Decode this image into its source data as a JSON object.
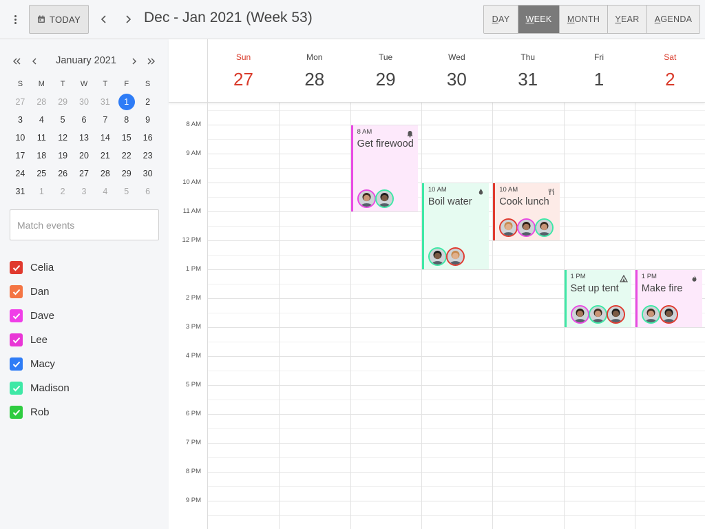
{
  "header": {
    "today_label": "TODAY",
    "title": "Dec - Jan 2021 (Week 53)",
    "views": [
      {
        "label": "DAY",
        "key": "D",
        "rest": "AY",
        "active": false
      },
      {
        "label": "WEEK",
        "key": "W",
        "rest": "EEK",
        "active": true
      },
      {
        "label": "MONTH",
        "key": "M",
        "rest": "ONTH",
        "active": false
      },
      {
        "label": "YEAR",
        "key": "Y",
        "rest": "EAR",
        "active": false
      },
      {
        "label": "AGENDA",
        "key": "A",
        "rest": "GENDA",
        "active": false
      }
    ]
  },
  "mini_calendar": {
    "title": "January 2021",
    "weekdays": [
      "S",
      "M",
      "T",
      "W",
      "T",
      "F",
      "S"
    ],
    "weeks": [
      [
        "27",
        "28",
        "29",
        "30",
        "31",
        "1",
        "2"
      ],
      [
        "3",
        "4",
        "5",
        "6",
        "7",
        "8",
        "9"
      ],
      [
        "10",
        "11",
        "12",
        "13",
        "14",
        "15",
        "16"
      ],
      [
        "17",
        "18",
        "19",
        "20",
        "21",
        "22",
        "23"
      ],
      [
        "24",
        "25",
        "26",
        "27",
        "28",
        "29",
        "30"
      ],
      [
        "31",
        "1",
        "2",
        "3",
        "4",
        "5",
        "6"
      ]
    ],
    "selected": "1"
  },
  "search": {
    "placeholder": "Match events",
    "value": ""
  },
  "people": [
    {
      "name": "Celia",
      "color": "#e03a2f"
    },
    {
      "name": "Dan",
      "color": "#f47544"
    },
    {
      "name": "Dave",
      "color": "#f03ee8"
    },
    {
      "name": "Lee",
      "color": "#e936d6"
    },
    {
      "name": "Macy",
      "color": "#2e7cf6"
    },
    {
      "name": "Madison",
      "color": "#3ee8a6"
    },
    {
      "name": "Rob",
      "color": "#2ecc40"
    }
  ],
  "week": {
    "days": [
      {
        "dow": "Sun",
        "num": "27",
        "weekend": true
      },
      {
        "dow": "Mon",
        "num": "28",
        "weekend": false
      },
      {
        "dow": "Tue",
        "num": "29",
        "weekend": false
      },
      {
        "dow": "Wed",
        "num": "30",
        "weekend": false
      },
      {
        "dow": "Thu",
        "num": "31",
        "weekend": false
      },
      {
        "dow": "Fri",
        "num": "1",
        "weekend": false
      },
      {
        "dow": "Sat",
        "num": "2",
        "weekend": true
      }
    ],
    "hours": [
      "8 AM",
      "9 AM",
      "10 AM",
      "11 AM",
      "12 PM",
      "1 PM",
      "2 PM",
      "3 PM",
      "4 PM",
      "5 PM",
      "6 PM",
      "7 PM",
      "8 PM",
      "9 PM"
    ]
  },
  "events": [
    {
      "day": 2,
      "start": 8,
      "end": 11,
      "time": "8 AM",
      "title": "Get firewood",
      "icon": "bell-icon",
      "bg": "#fde9fb",
      "border": "#e94ae3",
      "avatar_count": 2
    },
    {
      "day": 3,
      "start": 10,
      "end": 13,
      "time": "10 AM",
      "title": "Boil water",
      "icon": "water-drop-icon",
      "bg": "#e6fbf1",
      "border": "#3ee8a6",
      "avatar_count": 2
    },
    {
      "day": 4,
      "start": 10,
      "end": 12,
      "time": "10 AM",
      "title": "Cook lunch",
      "icon": "utensils-icon",
      "bg": "#fdebe7",
      "border": "#e03a2f",
      "avatar_count": 3
    },
    {
      "day": 5,
      "start": 13,
      "end": 15,
      "time": "1 PM",
      "title": "Set up tent",
      "icon": "tent-icon",
      "bg": "#e6fbf1",
      "border": "#3ee8a6",
      "avatar_count": 3
    },
    {
      "day": 6,
      "start": 13,
      "end": 15,
      "time": "1 PM",
      "title": "Make fire",
      "icon": "flame-icon",
      "bg": "#fde9fb",
      "border": "#e94ae3",
      "avatar_count": 2
    }
  ]
}
